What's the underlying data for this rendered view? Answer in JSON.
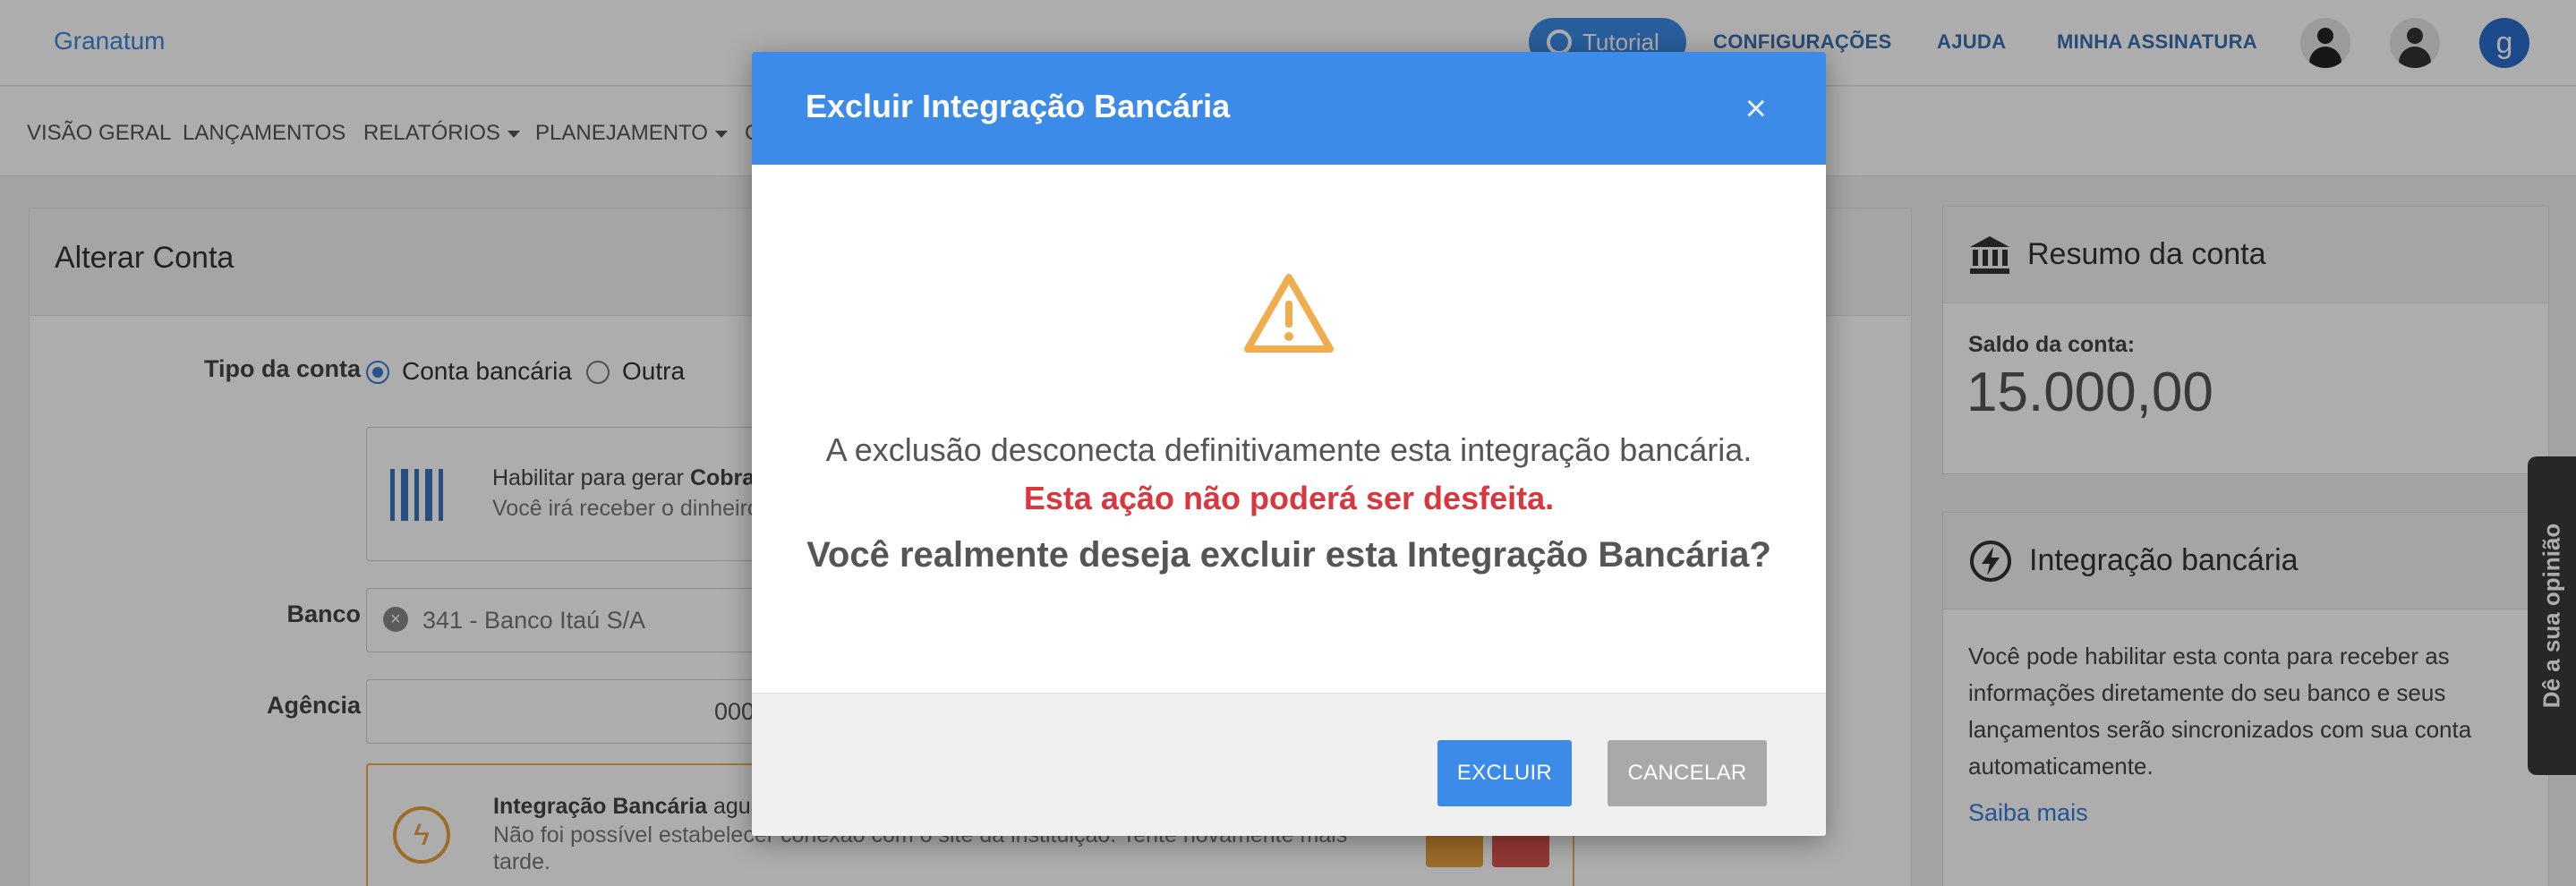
{
  "app": {
    "brand": "Granatum"
  },
  "topbar": {
    "tutorial_label": "Tutorial",
    "links": [
      "CONFIGURAÇÕES",
      "AJUDA",
      "MINHA ASSINATURA"
    ],
    "avatar_g": "g"
  },
  "nav": {
    "items": [
      "VISÃO GERAL",
      "LANÇAMENTOS",
      "RELATÓRIOS",
      "PLANEJAMENTO",
      "C"
    ]
  },
  "form": {
    "title": "Alterar Conta",
    "tipo_label": "Tipo da conta",
    "tipo_options": [
      "Conta bancária",
      "Outra"
    ],
    "tipo_selected": "Conta bancária",
    "cobranca_text_prefix": "Habilitar para gerar ",
    "cobranca_text_bold": "Cobran",
    "cobranca_sub": "Você irá receber o dinheiro",
    "banco_label": "Banco",
    "banco_value": "341 - Banco Itaú S/A",
    "agencia_label": "Agência",
    "agencia_value": "000",
    "integracao_bold": "Integração Bancária",
    "integracao_rest": " aguar",
    "integracao_line2": "Não foi possível estabelecer conexão com o site da instituição. Tente novamente mais",
    "integracao_line3": "tarde."
  },
  "resumo": {
    "title": "Resumo da conta",
    "saldo_label": "Saldo da conta:",
    "saldo_value": "15.000,00"
  },
  "integracao_card": {
    "title": "Integração bancária",
    "text": "Você pode habilitar esta conta para receber as informações diretamente do seu banco e seus lançamentos serão sincronizados com sua conta automaticamente.",
    "link": "Saiba mais"
  },
  "feedback_tab": "Dê a sua opinião",
  "modal": {
    "title": "Excluir Integração Bancária",
    "close": "×",
    "message": "A exclusão desconecta definitivamente esta integração bancária.",
    "warning": "Esta ação não poderá ser desfeita.",
    "question": "Você realmente deseja excluir esta Integração Bancária?",
    "confirm_label": "EXCLUIR",
    "cancel_label": "CANCELAR"
  },
  "colors": {
    "accent": "#3d8be8",
    "danger_text": "#d9363e",
    "warning_icon": "#f0ad4e",
    "cancel_button": "#a9a9a9"
  }
}
